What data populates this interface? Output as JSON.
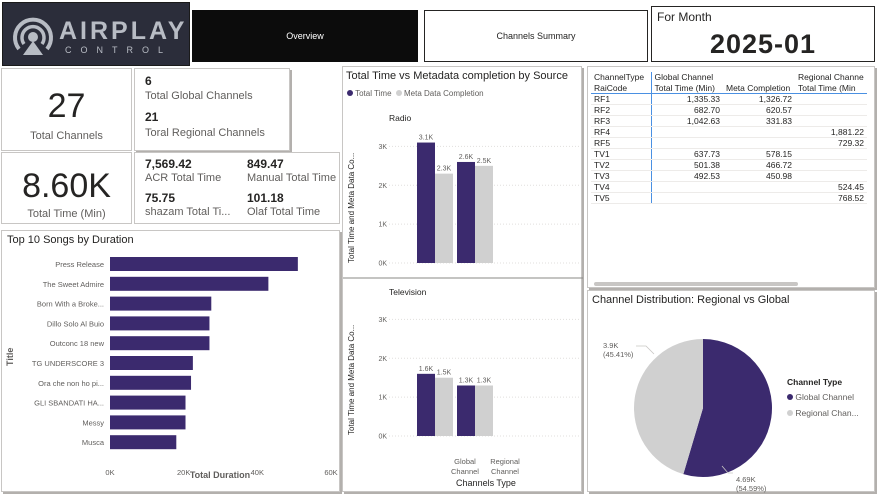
{
  "logo": {
    "text_top": "AIRPLAY",
    "text_bottom": "CONTROL"
  },
  "nav": {
    "overview": "Overview",
    "channels_summary": "Channels Summary"
  },
  "month": {
    "label": "For Month",
    "value": "2025-01"
  },
  "kpis": {
    "total_channels": {
      "value": "27",
      "label": "Total Channels"
    },
    "global_channels": {
      "value": "6",
      "label": "Total Global Channels"
    },
    "regional_channels": {
      "value": "21",
      "label": "Toral Regional Channels"
    },
    "total_time": {
      "value": "8.60K",
      "label": "Total Time (Min)"
    },
    "acr": {
      "value": "7,569.42",
      "label": "ACR Total Time"
    },
    "manual": {
      "value": "849.47",
      "label": "Manual Total Time"
    },
    "shazam": {
      "value": "75.75",
      "label": "shazam Total Ti..."
    },
    "olaf": {
      "value": "101.18",
      "label": "Olaf Total Time"
    }
  },
  "songs_chart": {
    "title": "Top 10 Songs by Duration",
    "xlabel": "Total Duration",
    "ylabel": "Title",
    "ticks": [
      "0K",
      "20K",
      "40K",
      "60K"
    ]
  },
  "source_chart": {
    "title": "Total Time vs Metadata completion by Source",
    "legend": [
      "Total Time",
      "Meta Data Completion"
    ],
    "ylabel": "Total Time and Meta Data Co...",
    "xlabel": "Channels Type",
    "panel_radio": "Radio",
    "panel_tv": "Television",
    "yticks": [
      "0K",
      "1K",
      "2K",
      "3K"
    ],
    "cat_global": [
      "Global",
      "Channel"
    ],
    "cat_regional": [
      "Regional",
      "Channel"
    ]
  },
  "pie_chart": {
    "title": "Channel Distribution: Regional vs Global",
    "legend_title": "Channel Type",
    "legend": [
      "Global Channel",
      "Regional Chan..."
    ],
    "label_regional": [
      "3.9K",
      "(45.41%)"
    ],
    "label_global": [
      "4.69K",
      "(54.59%)"
    ]
  },
  "matrix": {
    "headers": [
      [
        "ChannelType",
        "RaiCode"
      ],
      [
        "Global Channel",
        "Total Time (Min)"
      ],
      [
        "",
        "Meta Completion"
      ],
      [
        "Regional Channe",
        "Total Time (Min"
      ]
    ],
    "rows": [
      [
        "RF1",
        "1,335.33",
        "1,326.72",
        ""
      ],
      [
        "RF2",
        "682.70",
        "620.57",
        ""
      ],
      [
        "RF3",
        "1,042.63",
        "331.83",
        ""
      ],
      [
        "RF4",
        "",
        "",
        "1,881.22"
      ],
      [
        "RF5",
        "",
        "",
        "729.32"
      ],
      [
        "TV1",
        "637.73",
        "578.15",
        ""
      ],
      [
        "TV2",
        "501.38",
        "466.72",
        ""
      ],
      [
        "TV3",
        "492.53",
        "450.98",
        ""
      ],
      [
        "TV4",
        "",
        "",
        "524.45"
      ],
      [
        "TV5",
        "",
        "",
        "768.52"
      ]
    ]
  },
  "colors": {
    "primary": "#3b2a6e",
    "secondary": "#d0d0d0",
    "dark": "#0c0c0c"
  },
  "chart_data": [
    {
      "type": "bar",
      "title": "Top 10 Songs by Duration",
      "xlabel": "Total Duration",
      "ylabel": "Title",
      "orientation": "horizontal",
      "categories": [
        "Press Release",
        "The Sweet Admire",
        "Born With a Broke...",
        "Dillo Solo Al Buio",
        "Outconc 18 new",
        "TG UNDERSCORE 3",
        "Ora che non ho pi...",
        "GLI SBANDATI HA...",
        "Messy",
        "Musca"
      ],
      "values": [
        51000,
        43000,
        27500,
        27000,
        27000,
        22500,
        22000,
        20500,
        20500,
        18000
      ],
      "xlim": [
        0,
        60000
      ]
    },
    {
      "type": "bar",
      "title": "Total Time vs Metadata completion by Source",
      "panel": "Radio",
      "categories": [
        "Global Channel",
        "Regional Channel"
      ],
      "series": [
        {
          "name": "Total Time",
          "values": [
            3100,
            2600
          ],
          "labels": [
            "3.1K",
            "2.6K"
          ]
        },
        {
          "name": "Meta Data Completion",
          "values": [
            2300,
            2500
          ],
          "labels": [
            "2.3K",
            "2.5K"
          ]
        }
      ],
      "ylim": [
        0,
        3500
      ]
    },
    {
      "type": "bar",
      "title": "Total Time vs Metadata completion by Source",
      "panel": "Television",
      "categories": [
        "Global Channel",
        "Regional Channel"
      ],
      "series": [
        {
          "name": "Total Time",
          "values": [
            1600,
            1300
          ],
          "labels": [
            "1.6K",
            "1.3K"
          ]
        },
        {
          "name": "Meta Data Completion",
          "values": [
            1500,
            1300
          ],
          "labels": [
            "1.5K",
            "1.3K"
          ]
        }
      ],
      "ylim": [
        0,
        3500
      ]
    },
    {
      "type": "pie",
      "title": "Channel Distribution: Regional vs Global",
      "categories": [
        "Global Channel",
        "Regional Channel"
      ],
      "values": [
        4690,
        3900
      ],
      "percent": [
        54.59,
        45.41
      ]
    }
  ]
}
